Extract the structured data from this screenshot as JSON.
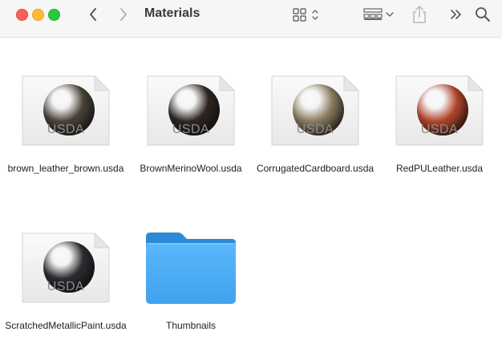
{
  "window": {
    "title": "Materials"
  },
  "toolbar": {
    "icons": [
      "back-chevron",
      "forward-chevron",
      "view-grid-toggle",
      "group-by",
      "share",
      "more-chevrons",
      "search"
    ]
  },
  "files": [
    {
      "name": "brown_leather_brown.usda",
      "badge": "USDA",
      "color": "#4a4238"
    },
    {
      "name": "BrownMerinoWool.usda",
      "badge": "USDA",
      "color": "#2e2622"
    },
    {
      "name": "CorrugatedCardboard.usda",
      "badge": "USDA",
      "color": "#8a7a5e"
    },
    {
      "name": "RedPULeather.usda",
      "badge": "USDA",
      "color": "#b2442a"
    },
    {
      "name": "ScratchedMetallicPaint.usda",
      "badge": "USDA",
      "color": "#2a2c30"
    }
  ],
  "folders": [
    {
      "name": "Thumbnails",
      "color": "#3a9af0"
    }
  ]
}
